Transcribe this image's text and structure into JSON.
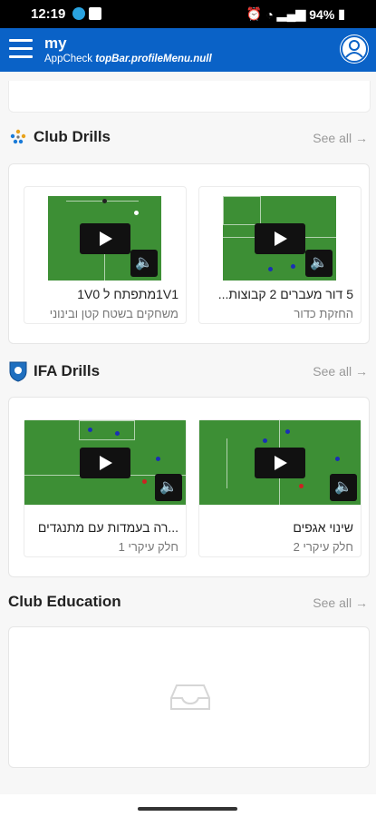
{
  "status_bar": {
    "time": "12:19",
    "battery": "94%"
  },
  "top_bar": {
    "brand": "my",
    "app_name": "AppCheck",
    "profile_menu_text": "topBar.profileMenu.null"
  },
  "sections": {
    "club_drills": {
      "title": "Club Drills",
      "see_all": "See all",
      "items": [
        {
          "title": "5 דור מעברים 2 קבוצות...",
          "subtitle": "החזקת כדור"
        },
        {
          "title": "1V1מתפתח ל 1V0",
          "subtitle": "משחקים בשטח קטן ובינוני"
        }
      ]
    },
    "ifa_drills": {
      "title": "IFA Drills",
      "see_all": "See all",
      "items": [
        {
          "title": "שינוי אגפים",
          "subtitle": "חלק עיקרי 2"
        },
        {
          "title": "...רה בעמדות עם מתנגדים",
          "subtitle": "חלק עיקרי 1"
        }
      ]
    },
    "club_education": {
      "title": "Club Education",
      "see_all": "See all"
    }
  },
  "colors": {
    "accent": "#0a62c7",
    "pitch": "#3d8f35"
  }
}
